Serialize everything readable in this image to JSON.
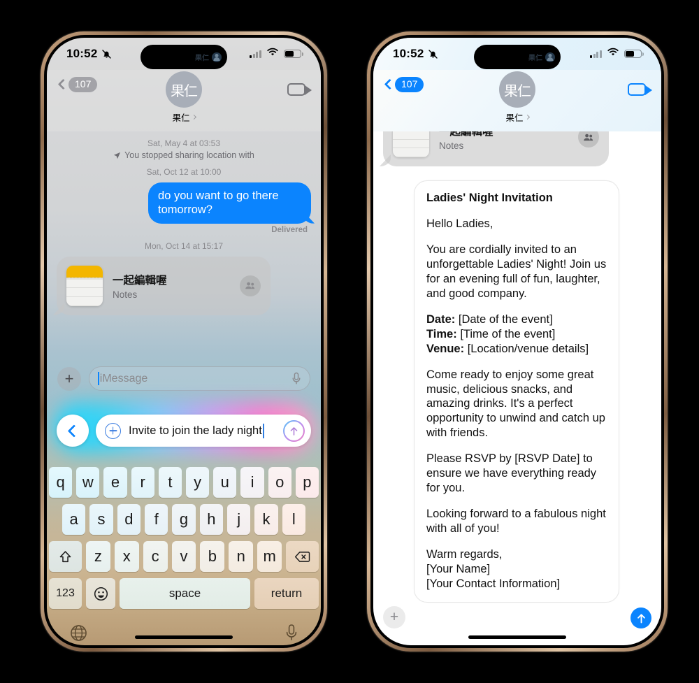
{
  "status_bar": {
    "time": "10:52",
    "silent_icon": "bell-slash-icon",
    "signal_icon": "cellular-bars-icon",
    "wifi_icon": "wifi-icon",
    "battery_icon": "battery-icon"
  },
  "dynamic_island": {
    "label": "果仁",
    "avatar_icon": "contact-avatar-icon"
  },
  "nav": {
    "back_count": "107",
    "back_icon": "chevron-left-icon",
    "contact_initials": "果仁",
    "contact_name": "果仁",
    "disclosure_icon": "chevron-right-icon",
    "facetime_icon": "video-camera-icon",
    "back_color_left": "#8e8e93",
    "back_color_right": "#0b84fe",
    "video_color_left": "#76767b",
    "video_color_right": "#0b84fe"
  },
  "left_phone": {
    "conversation": {
      "system_timestamp": "Sat, May 4 at 03:53",
      "system_text": "You stopped sharing location with",
      "system_icon": "location-arrow-icon",
      "timestamp_1": "Sat, Oct 12 at 10:00",
      "outgoing_message": "do you want to go there tomorrow?",
      "delivery_status": "Delivered",
      "timestamp_2": "Mon, Oct 14 at 15:17",
      "note_card": {
        "title": "一起編輯喔",
        "app": "Notes",
        "app_icon": "notes-app-icon",
        "collaborators_icon": "people-group-icon"
      }
    },
    "composer": {
      "plus_icon": "plus-icon",
      "placeholder": "iMessage",
      "mic_icon": "microphone-icon"
    },
    "siri_bar": {
      "back_icon": "chevron-left-icon",
      "add_icon": "circle-plus-icon",
      "text": "Invite to join the lady night",
      "send_icon": "arrow-up-circle-icon",
      "glow_colors": [
        "#1fd6ff",
        "#7fc9ff",
        "#cf9bf3",
        "#ff7ad1"
      ]
    },
    "keyboard": {
      "row1": [
        "q",
        "w",
        "e",
        "r",
        "t",
        "y",
        "u",
        "i",
        "o",
        "p"
      ],
      "row2": [
        "a",
        "s",
        "d",
        "f",
        "g",
        "h",
        "j",
        "k",
        "l"
      ],
      "row3": [
        "z",
        "x",
        "c",
        "v",
        "b",
        "n",
        "m"
      ],
      "shift_icon": "shift-arrow-icon",
      "backspace_icon": "backspace-icon",
      "numbers_key": "123",
      "emoji_icon": "emoji-smiley-icon",
      "space_key": "space",
      "return_key": "return",
      "globe_icon": "globe-icon",
      "dictation_icon": "microphone-icon"
    }
  },
  "right_phone": {
    "note_card": {
      "title": "一起編輯喔",
      "app": "Notes",
      "app_icon": "notes-app-icon",
      "collaborators_icon": "people-group-icon"
    },
    "draft": {
      "title": "Ladies' Night Invitation",
      "greeting": "Hello Ladies,",
      "intro": "You are cordially invited to an unforgettable Ladies' Night! Join us for an evening full of fun, laughter, and good company.",
      "details": [
        {
          "label": "Date:",
          "value": "[Date of the event]"
        },
        {
          "label": "Time:",
          "value": "[Time of the event]"
        },
        {
          "label": "Venue:",
          "value": "[Location/venue details]"
        }
      ],
      "body_2": "Come ready to enjoy some great music, delicious snacks, and amazing drinks. It's a perfect opportunity to unwind and catch up with friends.",
      "body_3": "Please RSVP by [RSVP Date] to ensure we have everything ready for you.",
      "body_4": "Looking forward to a fabulous night with all of you!",
      "signoff": "Warm regards,",
      "sign_name": "[Your Name]",
      "sign_contact": "[Your Contact Information]"
    },
    "composer": {
      "plus_icon": "plus-icon",
      "send_icon": "arrow-up-icon",
      "send_color": "#0b84fe"
    }
  }
}
